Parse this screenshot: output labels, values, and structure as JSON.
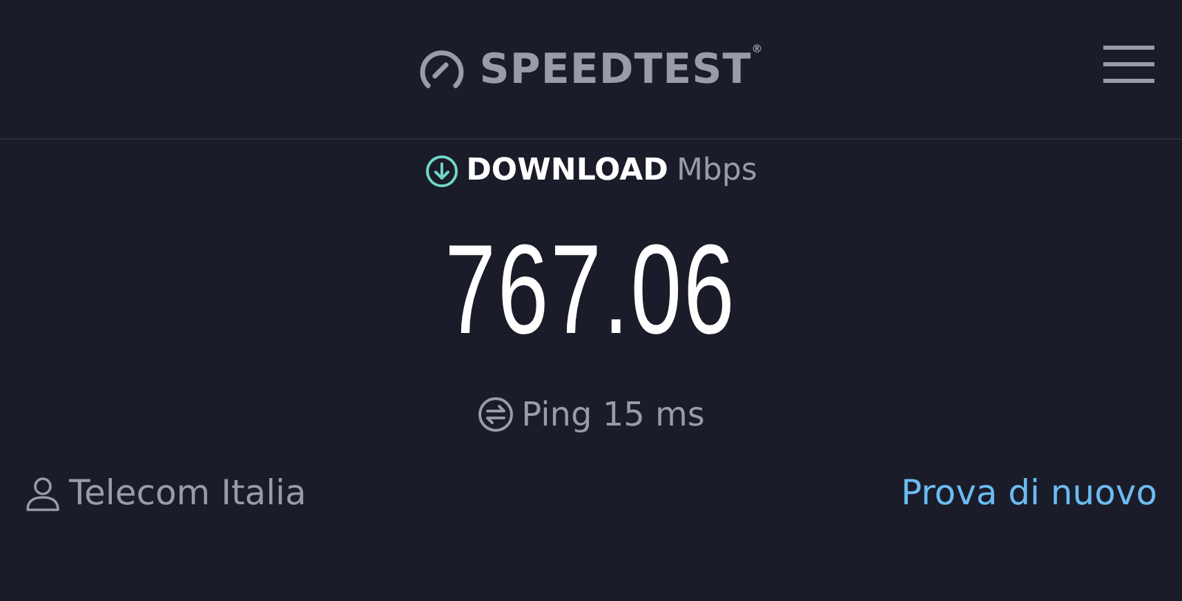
{
  "header": {
    "logo": "SPEEDTEST$^{®}$"
  },
  "result": {
    "label": "DOWNLOAD",
    "unit": "Mbps",
    "value": "767.06"
  },
  "ping": {
    "text": "Ping 15 ms"
  },
  "footer": {
    "provider": "Telecom Italia",
    "retry": "Prova di nuovo"
  }
}
